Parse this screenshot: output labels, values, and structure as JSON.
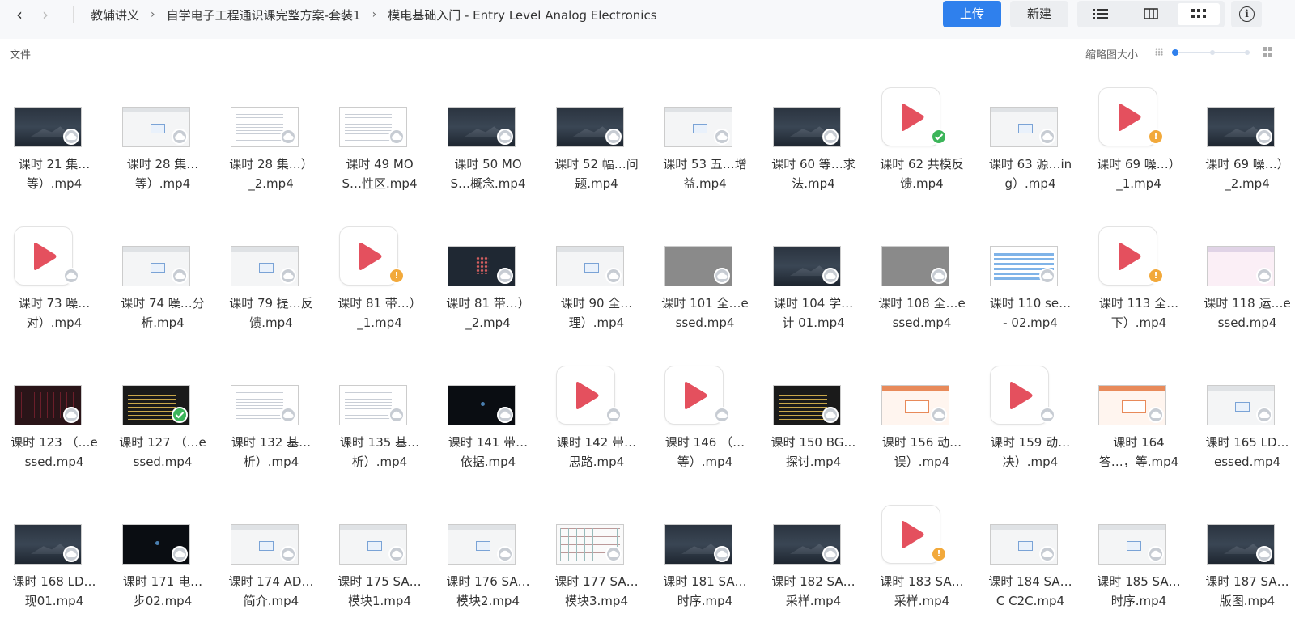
{
  "nav": {
    "back_icon": "chevron-left-icon",
    "forward_icon": "chevron-right-icon"
  },
  "breadcrumb": [
    "教辅讲义",
    "自学电子工程通识课完整方案-套装1",
    "模电基础入门 - Entry Level Analog Electronics"
  ],
  "toolbar": {
    "upload": "上传",
    "new": "新建",
    "view_modes": [
      "list-view-icon",
      "column-view-icon",
      "grid-view-icon"
    ],
    "active_view": "grid",
    "info_icon": "info-icon",
    "info_glyph": "i"
  },
  "subheader": {
    "column_label": "文件",
    "thumbnail_size_label": "缩略图大小",
    "thumbnail_size_level": 0.0
  },
  "colors": {
    "accent": "#2f80ed",
    "play": "#e4505e",
    "ok": "#3cb55a",
    "warn": "#f2a93b",
    "cloud": "#c7ccd3"
  },
  "files": [
    {
      "line1": "课时 21 集…",
      "line2": "等）.mp4",
      "thumb": "dark",
      "badge": "cloud"
    },
    {
      "line1": "课时 28 集…",
      "line2": "等）.mp4",
      "thumb": "light",
      "badge": "cloud"
    },
    {
      "line1": "课时 28 集…）",
      "line2": "_2.mp4",
      "thumb": "doc",
      "badge": "cloud"
    },
    {
      "line1": "课时 49 MO",
      "line2": "S…性区.mp4",
      "thumb": "doc",
      "badge": "cloud"
    },
    {
      "line1": "课时 50 MO",
      "line2": "S…概念.mp4",
      "thumb": "dark",
      "badge": "cloud"
    },
    {
      "line1": "课时 52 幅…问",
      "line2": "题.mp4",
      "thumb": "dark",
      "badge": "cloud"
    },
    {
      "line1": "课时 53 五…增",
      "line2": "益.mp4",
      "thumb": "light",
      "badge": "cloud"
    },
    {
      "line1": "课时 60 等…求",
      "line2": "法.mp4",
      "thumb": "dark",
      "badge": "cloud"
    },
    {
      "line1": "课时 62 共模反",
      "line2": "馈.mp4",
      "thumb": "play",
      "badge": "ok"
    },
    {
      "line1": "课时 63 源…in",
      "line2": "g）.mp4",
      "thumb": "light",
      "badge": "cloud"
    },
    {
      "line1": "课时 69 噪…）",
      "line2": "_1.mp4",
      "thumb": "play",
      "badge": "warn"
    },
    {
      "line1": "课时 69 噪…）",
      "line2": "_2.mp4",
      "thumb": "dark",
      "badge": "cloud"
    },
    {
      "line1": "课时 73 噪…",
      "line2": "对）.mp4",
      "thumb": "play",
      "badge": "cloud"
    },
    {
      "line1": "课时 74 噪…分",
      "line2": "析.mp4",
      "thumb": "light",
      "badge": "cloud"
    },
    {
      "line1": "课时 79 提…反",
      "line2": "馈.mp4",
      "thumb": "light",
      "badge": "cloud"
    },
    {
      "line1": "课时 81 带…）",
      "line2": "_1.mp4",
      "thumb": "play",
      "badge": "warn"
    },
    {
      "line1": "课时 81 带…）",
      "line2": "_2.mp4",
      "thumb": "net",
      "badge": "cloud"
    },
    {
      "line1": "课时 90 全…",
      "line2": "理）.mp4",
      "thumb": "light",
      "badge": "cloud"
    },
    {
      "line1": "课时 101 全…e",
      "line2": "ssed.mp4",
      "thumb": "gray",
      "badge": "cloud"
    },
    {
      "line1": "课时 104 学…",
      "line2": "计 01.mp4",
      "thumb": "dark",
      "badge": "cloud"
    },
    {
      "line1": "课时 108 全…e",
      "line2": "ssed.mp4",
      "thumb": "gray",
      "badge": "cloud"
    },
    {
      "line1": "课时 110 se…",
      "line2": "- 02.mp4",
      "thumb": "table",
      "badge": "cloud"
    },
    {
      "line1": "课时 113 全…",
      "line2": "下）.mp4",
      "thumb": "play",
      "badge": "warn"
    },
    {
      "line1": "课时 118 运…e",
      "line2": "ssed.mp4",
      "thumb": "pink",
      "badge": "cloud"
    },
    {
      "line1": "课时 123 （…e",
      "line2": "ssed.mp4",
      "thumb": "red",
      "badge": "cloud"
    },
    {
      "line1": "课时 127 （…e",
      "line2": "ssed.mp4",
      "thumb": "code",
      "badge": "ok"
    },
    {
      "line1": "课时 132 基…",
      "line2": "析）.mp4",
      "thumb": "doc",
      "badge": "cloud"
    },
    {
      "line1": "课时 135 基…",
      "line2": "析）.mp4",
      "thumb": "doc",
      "badge": "cloud"
    },
    {
      "line1": "课时 141 带…",
      "line2": "依据.mp4",
      "thumb": "black",
      "badge": "cloud"
    },
    {
      "line1": "课时 142 带…",
      "line2": "思路.mp4",
      "thumb": "play",
      "badge": "cloud"
    },
    {
      "line1": "课时 146 （…",
      "line2": "等）.mp4",
      "thumb": "play",
      "badge": "cloud"
    },
    {
      "line1": "课时 150 BG…",
      "line2": "探讨.mp4",
      "thumb": "code",
      "badge": "cloud"
    },
    {
      "line1": "课时 156 动…",
      "line2": "误）.mp4",
      "thumb": "orange",
      "badge": "cloud"
    },
    {
      "line1": "课时 159 动…",
      "line2": "决）.mp4",
      "thumb": "play",
      "badge": "cloud"
    },
    {
      "line1": "课时 164",
      "line2": "答…，等.mp4",
      "thumb": "orange",
      "badge": "cloud"
    },
    {
      "line1": "课时 165 LD…",
      "line2": "essed.mp4",
      "thumb": "light",
      "badge": "cloud"
    },
    {
      "line1": "课时 168 LD…",
      "line2": "现01.mp4",
      "thumb": "dark",
      "badge": "cloud"
    },
    {
      "line1": "课时 171 电…",
      "line2": "步02.mp4",
      "thumb": "black",
      "badge": "cloud"
    },
    {
      "line1": "课时 174 AD…",
      "line2": "简介.mp4",
      "thumb": "light",
      "badge": "cloud"
    },
    {
      "line1": "课时 175 SA…",
      "line2": "模块1.mp4",
      "thumb": "light",
      "badge": "cloud"
    },
    {
      "line1": "课时 176 SA…",
      "line2": "模块2.mp4",
      "thumb": "light",
      "badge": "cloud"
    },
    {
      "line1": "课时 177 SA…",
      "line2": "模块3.mp4",
      "thumb": "circuit",
      "badge": "cloud"
    },
    {
      "line1": "课时 181 SA…",
      "line2": "时序.mp4",
      "thumb": "dark",
      "badge": "cloud"
    },
    {
      "line1": "课时 182 SA…",
      "line2": "采样.mp4",
      "thumb": "dark",
      "badge": "cloud"
    },
    {
      "line1": "课时 183 SA…",
      "line2": "采样.mp4",
      "thumb": "play",
      "badge": "warn"
    },
    {
      "line1": "课时 184 SA…",
      "line2": "C C2C.mp4",
      "thumb": "light",
      "badge": "cloud"
    },
    {
      "line1": "课时 185 SA…",
      "line2": "时序.mp4",
      "thumb": "light",
      "badge": "cloud"
    },
    {
      "line1": "课时 187 SA…",
      "line2": "版图.mp4",
      "thumb": "dark",
      "badge": "cloud"
    }
  ]
}
